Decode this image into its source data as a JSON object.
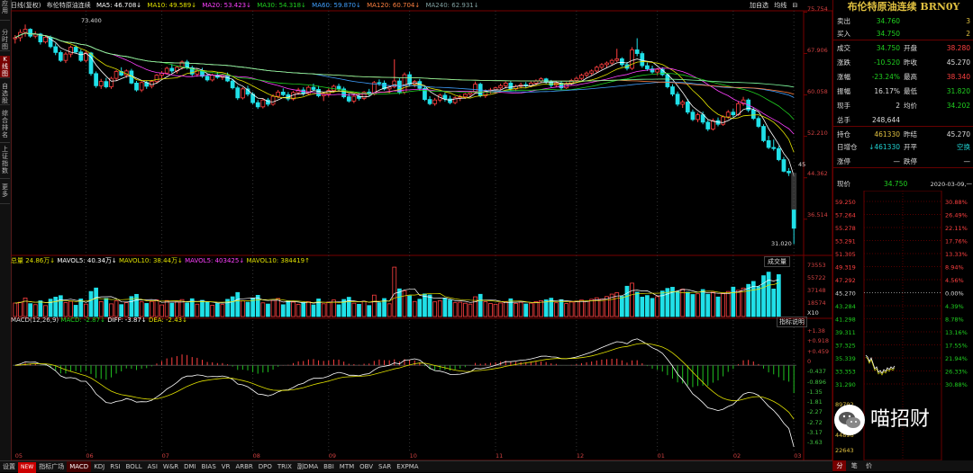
{
  "left_tabs": [
    "应用",
    "分时图",
    "K线图",
    "自选股",
    "综合排名",
    "上证指数",
    "更多"
  ],
  "info": {
    "period": "日线(复权)",
    "stock": "布伦特原油连续",
    "ma5": "MA5: 46.708↓",
    "ma10": "MA10: 49.589↓",
    "ma20": "MA20: 53.423↓",
    "ma30": "MA30: 54.318↓",
    "ma60": "MA60: 59.870↓",
    "ma120": "MA120: 60.704↓",
    "ma240": "MA240: 62.931↓"
  },
  "top_right": [
    "加自选",
    "均线",
    "⊟"
  ],
  "price_axis": [
    "75.754",
    "67.906",
    "60.058",
    "52.210",
    "44.362",
    "36.514"
  ],
  "price_annotations": {
    "high": "73.400",
    "low": "31.020",
    "last_tag": "45"
  },
  "vol_info": {
    "total": "总量 24.86万↓",
    "mavol5": "MAVOL5: 40.34万↓",
    "mavol10": "MAVOL10: 38.44万↓",
    "mavol5b": "MAVOL5: 403425↓",
    "mavol10b": "MAVOL10: 384419↑"
  },
  "vol_button": "成交量",
  "vol_axis": [
    "73553",
    "55722",
    "37148",
    "18574",
    "X10"
  ],
  "macd_info": {
    "title": "MACD(12,26,9)",
    "macd": "MACD: -2.87↓",
    "diff": "DIFF: -3.87↓",
    "dea": "DEA: -2.43↓"
  },
  "macd_button": "指标说明",
  "macd_axis": [
    "+1.38",
    "+0.918",
    "+0.459",
    "0",
    "-0.437",
    "-0.896",
    "-1.35",
    "-1.81",
    "-2.27",
    "-2.72",
    "-3.17",
    "-3.63"
  ],
  "months": [
    "05",
    "06",
    "07",
    "08",
    "09",
    "10",
    "11",
    "12",
    "01",
    "02",
    "03"
  ],
  "bottom_tabs": [
    "设置",
    "NEW",
    "指标广场",
    "MACD",
    "KDJ",
    "RSI",
    "BOLL",
    "ASI",
    "W&R",
    "DMI",
    "BIAS",
    "VR",
    "ARBR",
    "DPO",
    "TRIX",
    "副DMA",
    "BBI",
    "MTM",
    "OBV",
    "SAR",
    "EXPMA"
  ],
  "quote": {
    "name": "布伦特原油连续 BRN0Y",
    "rows": [
      {
        "k": "卖出",
        "v": "34.760",
        "c": "green",
        "k2": "",
        "v2": "3",
        "c2": "yellow"
      },
      {
        "k": "买入",
        "v": "34.750",
        "c": "green",
        "k2": "",
        "v2": "2",
        "c2": "yellow"
      },
      {
        "k": "成交",
        "v": "34.750",
        "c": "green",
        "k2": "开盘",
        "v2": "38.280",
        "c2": "red"
      },
      {
        "k": "涨跌",
        "v": "-10.520",
        "c": "green",
        "k2": "昨收",
        "v2": "45.270",
        "c2": "white"
      },
      {
        "k": "涨幅",
        "v": "-23.24%",
        "c": "green",
        "k2": "最高",
        "v2": "38.340",
        "c2": "red"
      },
      {
        "k": "振幅",
        "v": "16.17%",
        "c": "white",
        "k2": "最低",
        "v2": "31.820",
        "c2": "green"
      },
      {
        "k": "现手",
        "v": "2",
        "c": "white",
        "k2": "均价",
        "v2": "34.202",
        "c2": "green"
      },
      {
        "k": "总手",
        "v": "248,644",
        "c": "white",
        "k2": "",
        "v2": "",
        "c2": "white"
      },
      {
        "k": "持仓",
        "v": "461330",
        "c": "yellow",
        "k2": "昨结",
        "v2": "45.270",
        "c2": "white"
      },
      {
        "k": "日增仓",
        "v": "↓461330",
        "c": "cyan",
        "k2": "开平",
        "v2": "空换",
        "c2": "cyan"
      },
      {
        "k": "涨停",
        "v": "—",
        "c": "white",
        "k2": "跌停",
        "v2": "—",
        "c2": "white"
      }
    ],
    "now_label": "现价",
    "now_value": "34.750",
    "now_date": "2020-03-09,一"
  },
  "mini_left": [
    "59.250",
    "57.264",
    "55.278",
    "53.291",
    "51.305",
    "49.319",
    "47.292",
    "45.270",
    "43.284",
    "41.298",
    "39.311",
    "37.325",
    "35.339",
    "33.353",
    "31.290"
  ],
  "mini_right": [
    "30.88%",
    "26.49%",
    "22.11%",
    "17.76%",
    "13.33%",
    "8.94%",
    "4.56%",
    "0.00%",
    "4.39%",
    "8.78%",
    "13.16%",
    "17.55%",
    "21.94%",
    "26.33%",
    "30.88%"
  ],
  "mini_vol": [
    "89792",
    "67344",
    "44896",
    "22643"
  ],
  "mini_tabs": [
    "分",
    "笔",
    "价"
  ],
  "logo_text": "喵招财",
  "colors": {
    "up": "#ff4040",
    "down": "#20e0e8",
    "ma5": "#ffffff",
    "ma10": "#e0e000",
    "ma20": "#ff40ff",
    "ma30": "#20d020",
    "ma60": "#40a0ff",
    "ma120": "#ff8040",
    "ma240": "#80ffa0"
  },
  "chart_data": {
    "type": "candlestick",
    "ohlc": [
      [
        70.7,
        71.4,
        69.8,
        70.9
      ],
      [
        70.9,
        72.5,
        70.2,
        71.9
      ],
      [
        71.9,
        73.4,
        71.1,
        72.5
      ],
      [
        72.5,
        72.7,
        70.9,
        71.2
      ],
      [
        71.2,
        72.1,
        70.8,
        71.6
      ],
      [
        71.6,
        71.8,
        69.6,
        70.1
      ],
      [
        70.1,
        71.3,
        69.8,
        71.0
      ],
      [
        71.0,
        71.3,
        68.9,
        69.2
      ],
      [
        69.2,
        69.8,
        67.6,
        68.1
      ],
      [
        68.1,
        68.5,
        66.3,
        66.6
      ],
      [
        66.6,
        68.2,
        66.1,
        67.8
      ],
      [
        67.8,
        69.4,
        67.2,
        69.1
      ],
      [
        69.1,
        69.5,
        67.9,
        68.2
      ],
      [
        68.2,
        68.7,
        66.3,
        66.6
      ],
      [
        66.6,
        68.4,
        66.2,
        68.0
      ],
      [
        68.0,
        68.2,
        63.7,
        64.1
      ],
      [
        64.1,
        64.5,
        61.4,
        61.8
      ],
      [
        61.8,
        63.1,
        61.2,
        62.6
      ],
      [
        62.6,
        63.3,
        61.3,
        61.6
      ],
      [
        61.6,
        63.5,
        61.2,
        63.2
      ],
      [
        63.2,
        64.8,
        62.8,
        64.5
      ],
      [
        64.5,
        65.3,
        63.6,
        63.8
      ],
      [
        63.8,
        64.9,
        63.3,
        64.6
      ],
      [
        64.6,
        65.0,
        62.1,
        62.3
      ],
      [
        62.3,
        62.7,
        60.7,
        61.0
      ],
      [
        61.0,
        62.7,
        60.6,
        62.4
      ],
      [
        62.4,
        62.8,
        61.2,
        61.7
      ],
      [
        61.7,
        62.9,
        61.3,
        62.6
      ],
      [
        62.6,
        64.0,
        62.2,
        63.8
      ],
      [
        63.8,
        64.6,
        63.2,
        64.2
      ],
      [
        64.2,
        65.4,
        63.9,
        65.1
      ],
      [
        65.1,
        65.9,
        64.2,
        64.6
      ],
      [
        64.6,
        65.6,
        64.1,
        65.3
      ],
      [
        65.3,
        66.6,
        64.9,
        66.3
      ],
      [
        66.3,
        66.7,
        64.9,
        65.2
      ],
      [
        65.2,
        65.6,
        63.6,
        64.0
      ],
      [
        64.0,
        65.1,
        63.5,
        64.7
      ],
      [
        64.7,
        65.2,
        63.3,
        63.6
      ],
      [
        63.6,
        64.1,
        62.6,
        62.9
      ],
      [
        62.9,
        64.1,
        62.6,
        63.8
      ],
      [
        63.8,
        64.4,
        63.1,
        63.4
      ],
      [
        63.4,
        64.1,
        62.9,
        63.8
      ],
      [
        63.8,
        64.3,
        62.5,
        62.7
      ],
      [
        62.7,
        63.1,
        61.1,
        61.4
      ],
      [
        61.4,
        61.8,
        59.1,
        59.5
      ],
      [
        59.5,
        61.5,
        59.2,
        61.2
      ],
      [
        61.2,
        61.8,
        59.8,
        60.2
      ],
      [
        60.2,
        60.6,
        58.3,
        58.6
      ],
      [
        58.6,
        59.1,
        57.4,
        57.8
      ],
      [
        57.8,
        59.4,
        57.5,
        59.1
      ],
      [
        59.1,
        59.5,
        57.9,
        58.3
      ],
      [
        58.3,
        60.2,
        58.0,
        59.8
      ],
      [
        59.8,
        61.0,
        59.4,
        60.6
      ],
      [
        60.6,
        61.3,
        59.8,
        60.1
      ],
      [
        60.1,
        60.6,
        58.9,
        59.3
      ],
      [
        59.3,
        60.8,
        59.0,
        60.5
      ],
      [
        60.5,
        61.4,
        60.1,
        61.0
      ],
      [
        61.0,
        61.5,
        59.9,
        60.3
      ],
      [
        60.3,
        61.8,
        60.0,
        61.5
      ],
      [
        61.5,
        62.2,
        60.8,
        61.1
      ],
      [
        61.1,
        61.8,
        59.6,
        59.9
      ],
      [
        59.9,
        60.6,
        58.9,
        60.2
      ],
      [
        60.2,
        61.3,
        59.7,
        60.9
      ],
      [
        60.9,
        62.0,
        60.5,
        61.7
      ],
      [
        61.7,
        62.2,
        60.9,
        61.2
      ],
      [
        61.2,
        61.6,
        59.4,
        59.7
      ],
      [
        59.7,
        60.3,
        58.6,
        58.9
      ],
      [
        58.9,
        60.1,
        58.5,
        59.8
      ],
      [
        59.8,
        60.4,
        59.0,
        59.4
      ],
      [
        59.4,
        60.8,
        59.1,
        60.6
      ],
      [
        60.6,
        61.2,
        59.9,
        60.2
      ],
      [
        60.2,
        62.7,
        60.0,
        62.4
      ],
      [
        62.4,
        63.0,
        61.8,
        62.3
      ],
      [
        62.3,
        62.8,
        60.9,
        61.2
      ],
      [
        61.2,
        61.9,
        60.4,
        61.6
      ],
      [
        61.6,
        66.8,
        61.3,
        62.7
      ],
      [
        62.7,
        63.2,
        60.2,
        60.6
      ],
      [
        60.6,
        64.3,
        60.2,
        63.9
      ],
      [
        63.9,
        64.5,
        61.7,
        62.1
      ],
      [
        62.1,
        62.9,
        61.5,
        62.6
      ],
      [
        62.6,
        63.1,
        60.9,
        61.3
      ],
      [
        61.3,
        61.8,
        58.9,
        59.2
      ],
      [
        59.2,
        59.8,
        58.1,
        58.4
      ],
      [
        58.4,
        59.5,
        58.0,
        59.1
      ],
      [
        59.1,
        60.3,
        58.7,
        60.0
      ],
      [
        60.0,
        60.5,
        58.8,
        59.3
      ],
      [
        59.3,
        59.9,
        58.3,
        58.6
      ],
      [
        58.6,
        59.8,
        58.3,
        59.5
      ],
      [
        59.5,
        60.1,
        58.9,
        59.7
      ],
      [
        59.7,
        60.4,
        59.3,
        60.2
      ],
      [
        60.2,
        60.8,
        59.7,
        60.5
      ],
      [
        60.5,
        62.6,
        60.3,
        62.1
      ],
      [
        62.1,
        62.4,
        59.6,
        59.9
      ],
      [
        59.9,
        61.1,
        59.5,
        60.8
      ],
      [
        60.8,
        61.4,
        60.3,
        61.0
      ],
      [
        61.0,
        61.6,
        60.5,
        61.4
      ],
      [
        61.4,
        62.2,
        61.0,
        61.8
      ],
      [
        61.8,
        62.6,
        61.3,
        62.3
      ],
      [
        62.3,
        62.8,
        60.9,
        61.2
      ],
      [
        61.2,
        62.0,
        60.8,
        61.7
      ],
      [
        61.7,
        62.4,
        61.3,
        62.0
      ],
      [
        62.0,
        62.5,
        61.4,
        61.8
      ],
      [
        61.8,
        62.6,
        61.5,
        62.3
      ],
      [
        62.3,
        63.0,
        61.9,
        62.7
      ],
      [
        62.7,
        63.4,
        62.3,
        63.1
      ],
      [
        63.1,
        63.3,
        62.1,
        62.5
      ],
      [
        62.5,
        62.9,
        61.5,
        61.9
      ],
      [
        61.9,
        62.6,
        61.6,
        62.3
      ],
      [
        62.3,
        62.7,
        61.1,
        61.4
      ],
      [
        61.4,
        62.5,
        61.2,
        62.2
      ],
      [
        62.2,
        63.1,
        61.9,
        62.8
      ],
      [
        62.8,
        63.5,
        62.4,
        63.2
      ],
      [
        63.2,
        64.1,
        62.9,
        63.8
      ],
      [
        63.8,
        64.5,
        63.4,
        64.2
      ],
      [
        64.2,
        64.9,
        63.8,
        64.6
      ],
      [
        64.6,
        65.6,
        64.3,
        65.3
      ],
      [
        65.3,
        66.1,
        64.9,
        65.8
      ],
      [
        65.8,
        66.4,
        65.2,
        66.1
      ],
      [
        66.1,
        66.9,
        65.6,
        66.6
      ],
      [
        66.6,
        68.8,
        66.3,
        66.9
      ],
      [
        66.9,
        67.2,
        65.4,
        65.8
      ],
      [
        65.8,
        66.3,
        64.7,
        65.1
      ],
      [
        65.1,
        69.1,
        64.8,
        68.6
      ],
      [
        68.6,
        70.8,
        67.4,
        67.9
      ],
      [
        67.9,
        68.3,
        65.2,
        65.6
      ],
      [
        65.6,
        66.2,
        64.6,
        65.0
      ],
      [
        65.0,
        65.6,
        64.1,
        64.4
      ],
      [
        64.4,
        65.2,
        63.8,
        64.9
      ],
      [
        64.9,
        65.3,
        63.6,
        63.9
      ],
      [
        63.9,
        64.2,
        61.3,
        61.6
      ],
      [
        61.6,
        62.1,
        59.8,
        60.2
      ],
      [
        60.2,
        60.7,
        57.9,
        58.3
      ],
      [
        58.3,
        59.1,
        57.6,
        58.7
      ],
      [
        58.7,
        59.3,
        56.4,
        56.8
      ],
      [
        56.8,
        57.3,
        55.1,
        55.4
      ],
      [
        55.4,
        56.7,
        54.9,
        56.3
      ],
      [
        56.3,
        56.9,
        54.5,
        54.9
      ],
      [
        54.9,
        55.3,
        53.2,
        53.6
      ],
      [
        53.6,
        55.6,
        53.3,
        55.2
      ],
      [
        55.2,
        55.8,
        54.1,
        54.5
      ],
      [
        54.5,
        56.2,
        54.2,
        55.9
      ],
      [
        55.9,
        57.2,
        55.5,
        56.8
      ],
      [
        56.8,
        57.4,
        55.9,
        56.3
      ],
      [
        56.3,
        58.8,
        56.1,
        58.4
      ],
      [
        58.4,
        59.7,
        58.0,
        59.1
      ],
      [
        59.1,
        59.4,
        56.8,
        57.2
      ],
      [
        57.2,
        57.7,
        55.3,
        55.6
      ],
      [
        55.6,
        56.0,
        53.8,
        54.1
      ],
      [
        54.1,
        54.5,
        51.1,
        51.4
      ],
      [
        51.4,
        52.3,
        49.8,
        50.1
      ],
      [
        50.1,
        51.6,
        49.5,
        49.9
      ],
      [
        49.9,
        50.4,
        47.5,
        47.8
      ],
      [
        47.8,
        48.3,
        45.4,
        45.6
      ],
      [
        45.6,
        46.2,
        44.7,
        45.3
      ],
      [
        38.3,
        38.3,
        31.8,
        34.8
      ]
    ],
    "volume": [
      20100,
      21300,
      27600,
      19200,
      17700,
      23400,
      16300,
      25900,
      28900,
      31100,
      20800,
      22700,
      16800,
      26200,
      18500,
      37300,
      42500,
      22200,
      27000,
      18900,
      23300,
      17800,
      20600,
      29800,
      33000,
      21900,
      19500,
      22500,
      24800,
      17300,
      23800,
      19800,
      21900,
      25200,
      20300,
      26500,
      18400,
      24100,
      22200,
      16900,
      19400,
      17900,
      25600,
      29400,
      35800,
      23200,
      21300,
      27500,
      31600,
      20400,
      18600,
      24000,
      26900,
      17600,
      23400,
      21500,
      18100,
      20800,
      22300,
      17300,
      26200,
      19000,
      21600,
      24700,
      17500,
      25400,
      28700,
      19900,
      18200,
      22800,
      16400,
      31900,
      20600,
      26800,
      19000,
      73553,
      41200,
      38200,
      30700,
      22400,
      25800,
      33700,
      32200,
      21900,
      23500,
      27200,
      24700,
      20600,
      21300,
      19800,
      18500,
      29400,
      33100,
      22000,
      19400,
      18300,
      20200,
      21900,
      26400,
      19600,
      21200,
      18700,
      19900,
      22200,
      23600,
      24900,
      27300,
      20500,
      25100,
      19300,
      21600,
      23000,
      24500,
      22800,
      25700,
      27900,
      26000,
      29800,
      33400,
      35500,
      30100,
      45100,
      49700,
      36300,
      28900,
      31300,
      27000,
      29600,
      38000,
      41900,
      43600,
      37500,
      40800,
      36300,
      32800,
      33900,
      40200,
      33200,
      36100,
      29100,
      34000,
      37300,
      43800,
      39000,
      42400,
      47900,
      52300,
      44600,
      60800,
      66100,
      41000,
      62400
    ]
  }
}
